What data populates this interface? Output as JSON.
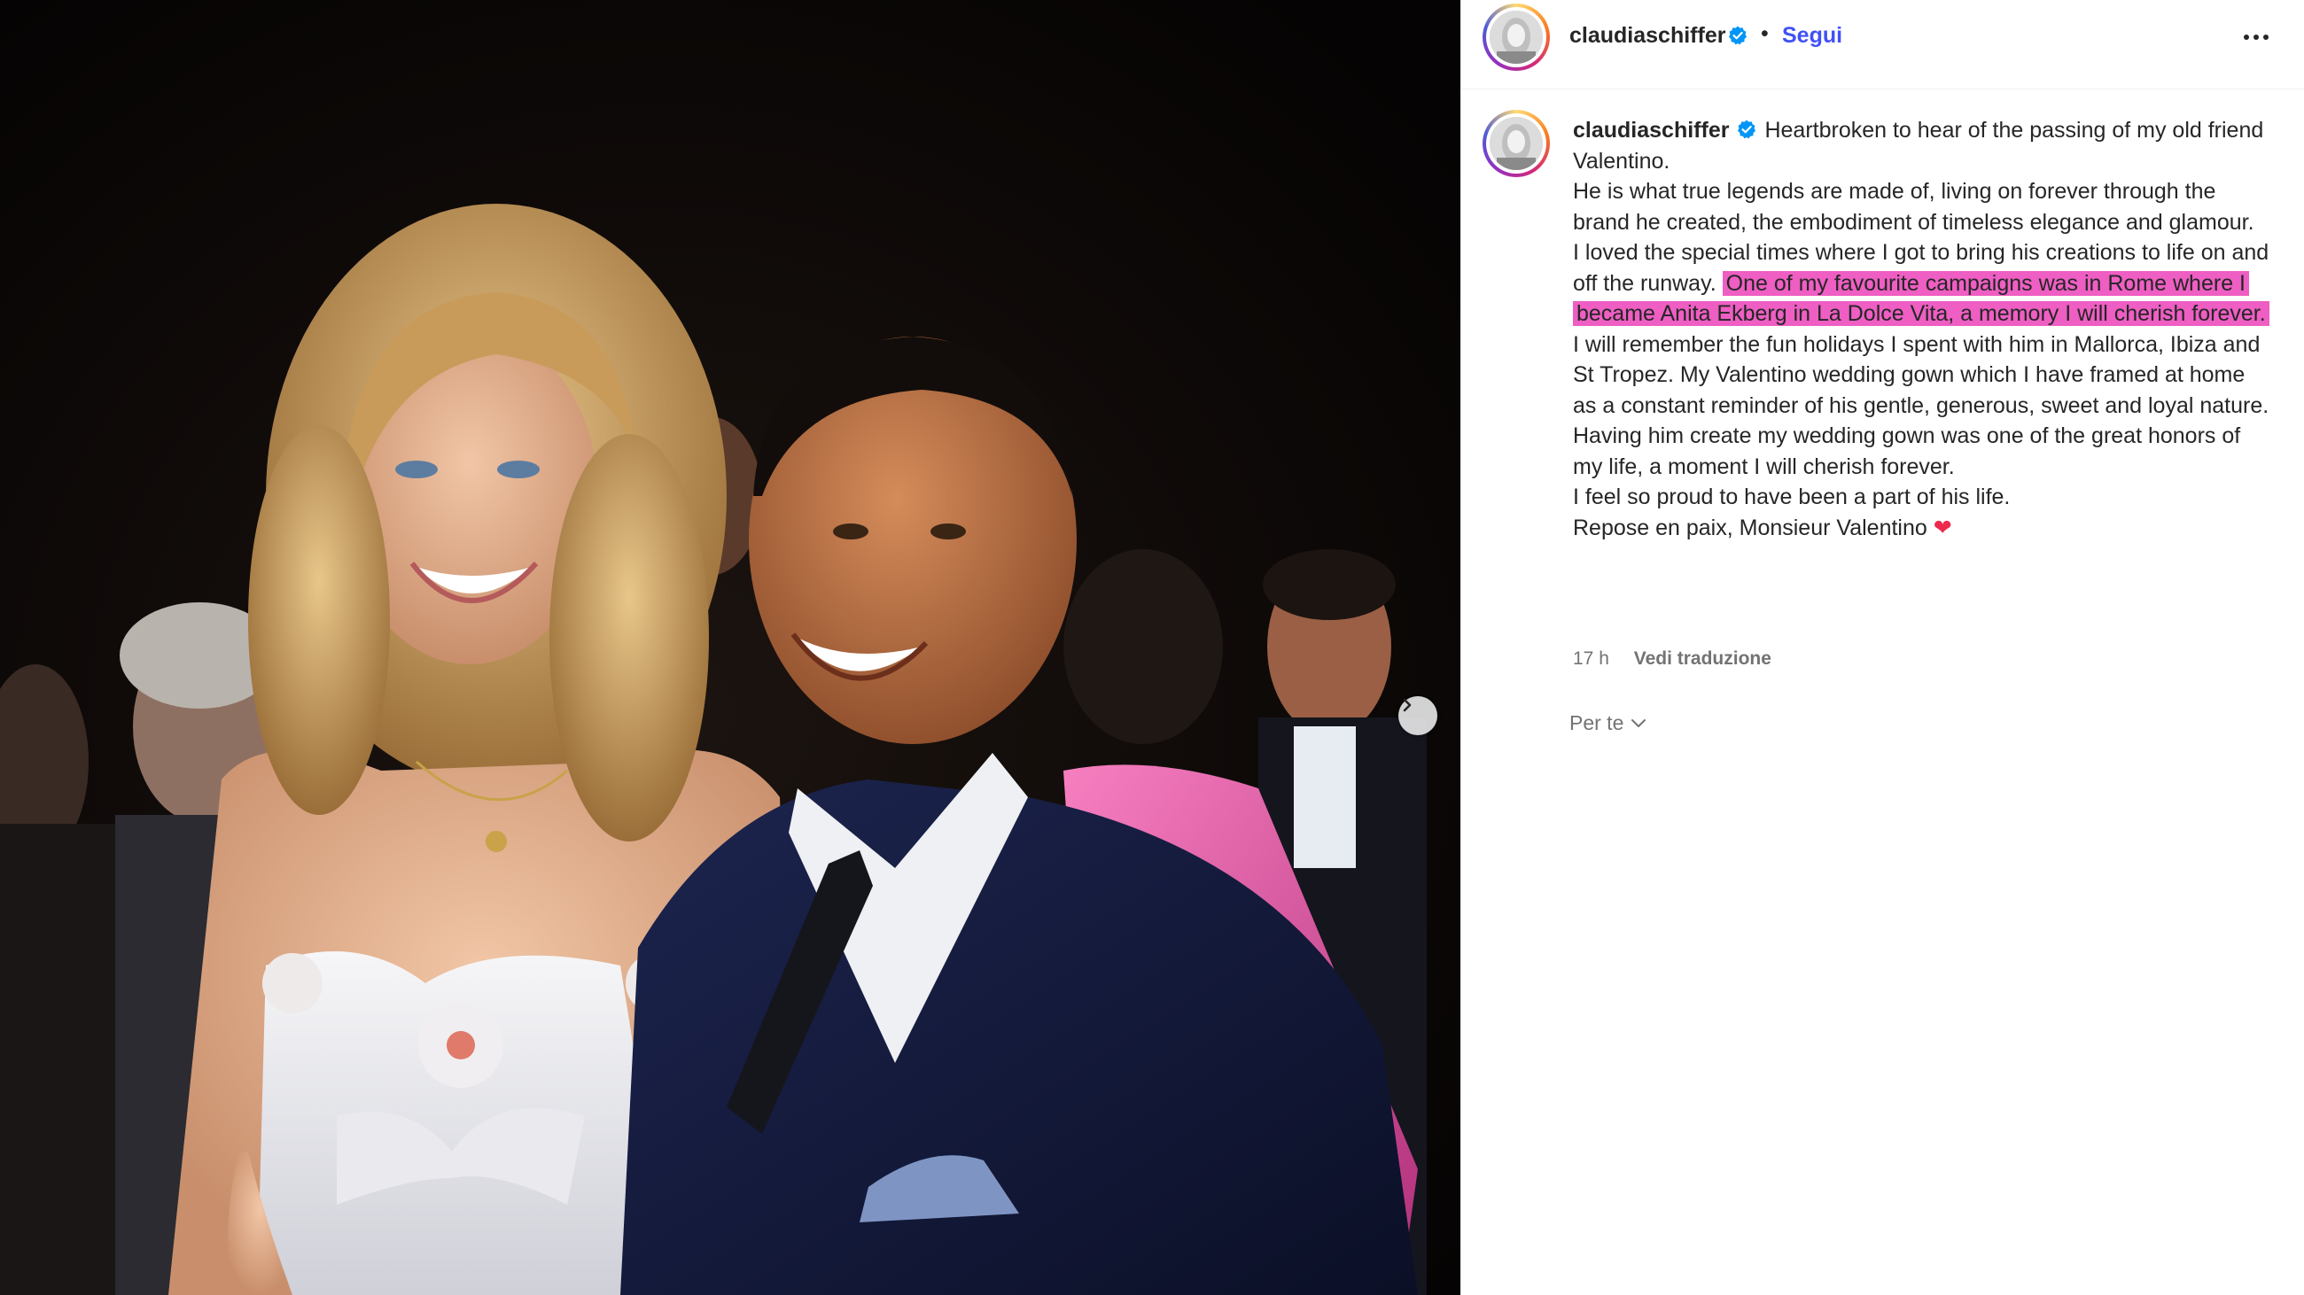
{
  "post": {
    "username": "claudiaschiffer",
    "verified": true,
    "separator": "•",
    "follow_label": "Segui",
    "more_icon": "more-horizontal-icon",
    "next_icon": "chevron-right-icon"
  },
  "caption": {
    "username": "claudiaschiffer",
    "line_1": "Heartbroken to hear of the passing of my old friend Valentino.",
    "line_2": "He is what true legends are made of, living on forever through the brand he created, the embodiment of timeless elegance and glamour.",
    "line_3_plain": "I loved the special times where I got to bring his creations to life on and off the runway.",
    "line_3_highlight": "One of my favourite campaigns was in Rome where I became Anita Ekberg in La Dolce Vita, a memory I will cherish forever.",
    "line_4": "I will remember the fun holidays I spent with him in Mallorca, Ibiza and St Tropez. My Valentino wedding gown which I have framed at home as a constant reminder of his gentle, generous, sweet and loyal nature. Having him create my wedding gown was one of the great honors of my life, a moment I will cherish forever.",
    "line_5": "I feel so proud to have been a part of his life.",
    "line_6": "Repose en paix, Monsieur Valentino",
    "emoji": "❤"
  },
  "meta": {
    "time": "17 h",
    "translate_label": "Vedi traduzione"
  },
  "feed_filter": {
    "label": "Per te",
    "icon": "chevron-down-icon"
  },
  "colors": {
    "highlight": "#ee5ec3",
    "follow": "#4150f7",
    "verified": "#0095f6",
    "heart": "#ed2a4d"
  }
}
